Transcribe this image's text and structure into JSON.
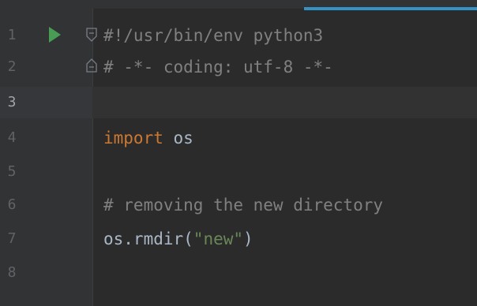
{
  "editor": {
    "lines": [
      {
        "number": "1",
        "code": "#!/usr/bin/env python3"
      },
      {
        "number": "2",
        "code": "# -*- coding: utf-8 -*-"
      },
      {
        "number": "3",
        "code": ""
      },
      {
        "number": "4",
        "keyword": "import",
        "rest": " os"
      },
      {
        "number": "5",
        "code": ""
      },
      {
        "number": "6",
        "code": "# removing the new directory"
      },
      {
        "number": "7",
        "call": "os.rmdir(",
        "string": "\"new\"",
        "close": ")"
      },
      {
        "number": "8",
        "code": ""
      }
    ],
    "current_line": "3",
    "colors": {
      "background": "#2b2b2b",
      "gutter": "#313335",
      "current_line": "#323232",
      "comment": "#808080",
      "keyword": "#cc7832",
      "identifier": "#a9b7c6",
      "string": "#6a8759",
      "line_number": "#606366",
      "run_icon": "#499c54",
      "tab_accent": "#3592c4"
    },
    "icons": [
      "run-icon",
      "fold-start-icon",
      "fold-end-icon"
    ]
  }
}
